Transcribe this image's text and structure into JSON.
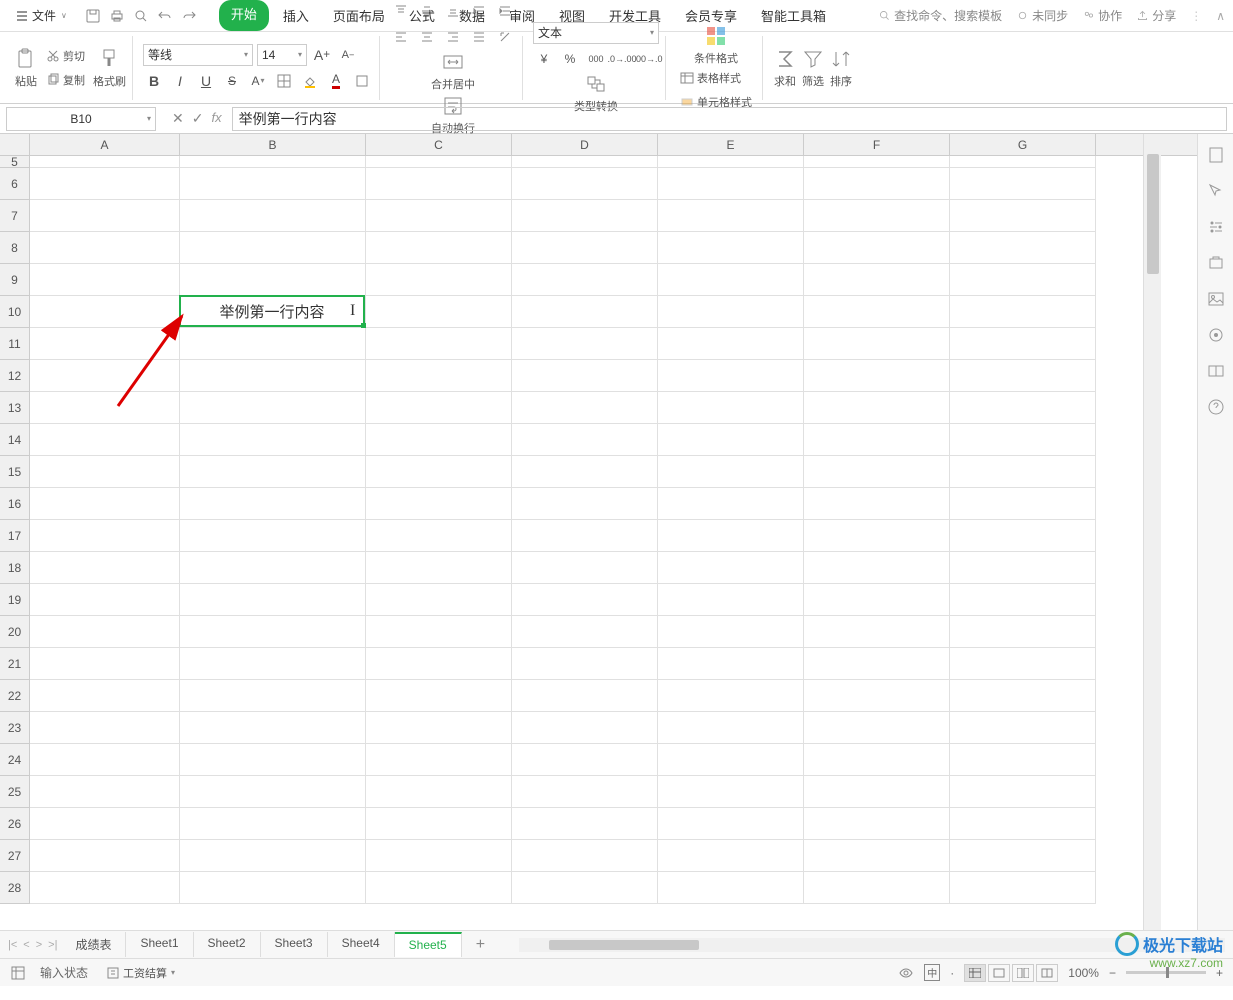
{
  "menu": {
    "file": "文件",
    "tabs": [
      "开始",
      "插入",
      "页面布局",
      "公式",
      "数据",
      "审阅",
      "视图",
      "开发工具",
      "会员专享",
      "智能工具箱"
    ],
    "active_tab": "开始",
    "search_placeholder": "查找命令、搜索模板",
    "right": {
      "unsync": "未同步",
      "collab": "协作",
      "share": "分享"
    }
  },
  "ribbon": {
    "paste": "粘贴",
    "cut": "剪切",
    "copy": "复制",
    "format_painter": "格式刷",
    "font_name": "等线",
    "font_size": "14",
    "merge_center": "合并居中",
    "wrap_text": "自动换行",
    "number_format": "文本",
    "type_convert": "类型转换",
    "cond_format": "条件格式",
    "table_style": "表格样式",
    "cell_style": "单元格样式",
    "sum": "求和",
    "filter": "筛选",
    "sort": "排序"
  },
  "formula_bar": {
    "cell_ref": "B10",
    "formula": "举例第一行内容"
  },
  "grid": {
    "columns": [
      "A",
      "B",
      "C",
      "D",
      "E",
      "F",
      "G"
    ],
    "first_row": 5,
    "row_count": 24,
    "active": {
      "row": 10,
      "col": "B",
      "value": "举例第一行内容"
    }
  },
  "sheets": {
    "tabs": [
      "成绩表",
      "Sheet1",
      "Sheet2",
      "Sheet3",
      "Sheet4",
      "Sheet5"
    ],
    "active": "Sheet5"
  },
  "status": {
    "mode": "输入状态",
    "salary": "工资结算",
    "zoom": "100%"
  },
  "watermark": {
    "name": "极光下载站",
    "url": "www.xz7.com"
  }
}
